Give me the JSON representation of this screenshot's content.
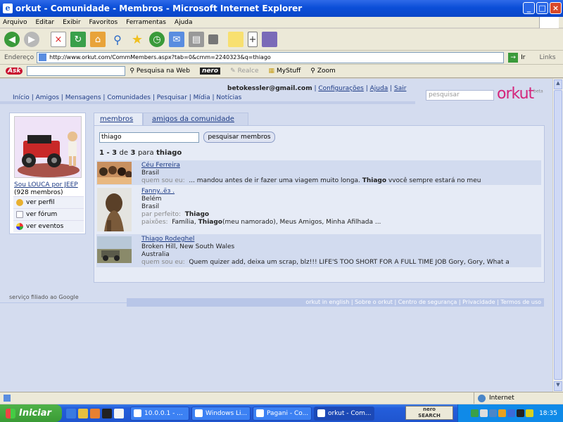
{
  "window": {
    "title": "orkut - Comunidade - Membros - Microsoft Internet Explorer"
  },
  "menu": [
    "Arquivo",
    "Editar",
    "Exibir",
    "Favoritos",
    "Ferramentas",
    "Ajuda"
  ],
  "address": {
    "label": "Endereço",
    "url": "http://www.orkut.com/CommMembers.aspx?tab=0&cmm=2240323&q=thiago",
    "go": "Ir",
    "links": "Links"
  },
  "ask_toolbar": {
    "logo": "Ask",
    "search_label": "Pesquisa na Web",
    "nero": "nero",
    "realce": "Realce",
    "mystuff": "MyStuff",
    "zoom": "Zoom"
  },
  "orkut": {
    "nav": [
      "Início",
      "Amigos",
      "Mensagens",
      "Comunidades",
      "Pesquisar",
      "Mídia",
      "Notícias"
    ],
    "user_email": "betokessler@gmail.com",
    "user_links": [
      "Configurações",
      "Ajuda",
      "Sair"
    ],
    "search_placeholder": "pesquisar",
    "logo": "orkut",
    "logo_beta": "beta",
    "community": {
      "name": "Sou LOUCA por JEEP",
      "members": "(928 membros)"
    },
    "left_menu": [
      "ver perfil",
      "ver fórum",
      "ver eventos"
    ],
    "tabs": [
      "membros",
      "amigos da comunidade"
    ],
    "search_value": "thiago",
    "search_button": "pesquisar membros",
    "result_range": "1 - 3",
    "result_de": "de",
    "result_total": "3",
    "result_para": "para",
    "result_query": "thiago",
    "results": [
      {
        "name": "Céu Ferreira",
        "line1": "Brasil",
        "label2": "quem sou eu:",
        "val2_pre": "... mandou antes de ir fazer uma viagem muito longa. ",
        "val2_bold": "Thiago",
        "val2_post": " vvocê sempre estará no meu"
      },
      {
        "name": "Fanny..ёз .",
        "line1": "Belém",
        "line2": "Brasil",
        "label3": "par perfeito:",
        "val3": "Thiago",
        "label4": "paixões:",
        "val4_pre": "Família, ",
        "val4_bold": "Thiago",
        "val4_post": "(meu namorado), Meus Amigos, Minha Afilhada ..."
      },
      {
        "name": "Thiago Rodeghel",
        "line1": "Broken Hill, New South Wales",
        "line2": "Australia",
        "label3": "quem sou eu:",
        "val3": "Quem quizer add, deixa um scrap, blz!!! LIFE'S TOO SHORT FOR A FULL TIME JOB Gory, Gory, What a"
      }
    ],
    "footer_left": "serviço filiado ao Google",
    "footer_links": [
      "orkut in english",
      "Sobre o orkut",
      "Centro de segurança",
      "Privacidade",
      "Termos de uso"
    ]
  },
  "statusbar": {
    "zone": "Internet"
  },
  "taskbar": {
    "start": "Iniciar",
    "tasks": [
      "10.0.0.1 - ...",
      "Windows Li...",
      "Pagani - Co...",
      "orkut - Com..."
    ],
    "nero_search": "nero",
    "nero_search_sub": "SEARCH",
    "clock": "18:35"
  }
}
